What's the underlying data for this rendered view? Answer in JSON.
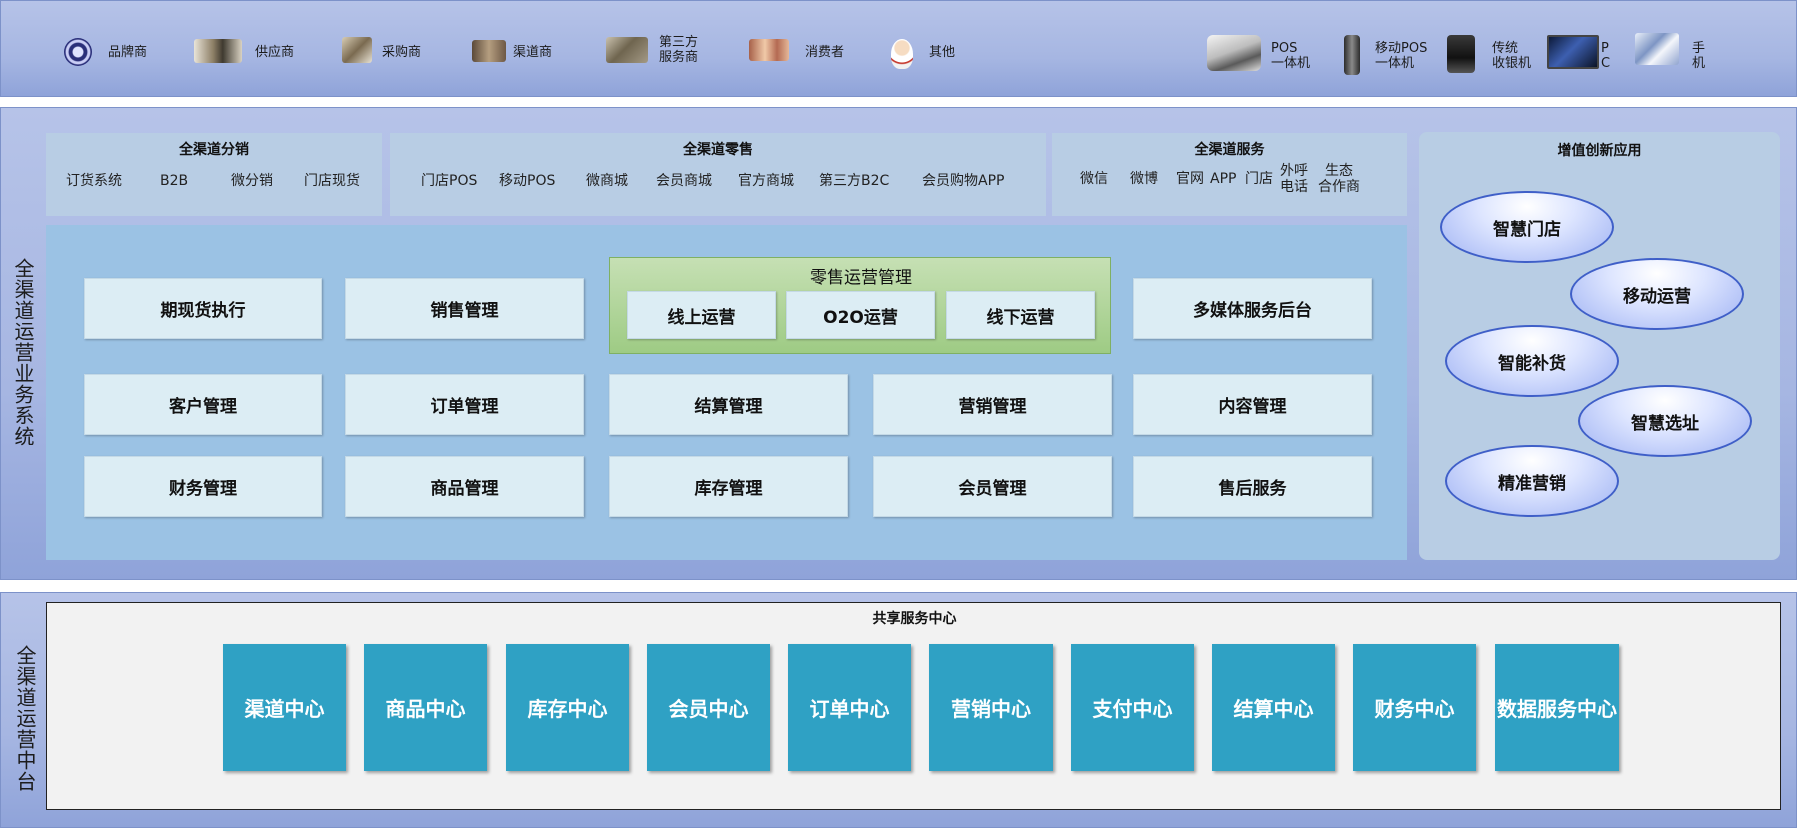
{
  "actors": {
    "left": [
      {
        "icon": "brand-seal-icon",
        "label": "品牌商"
      },
      {
        "icon": "supplier-photo-icon",
        "label": "供应商"
      },
      {
        "icon": "buyer-photo-icon",
        "label": "采购商"
      },
      {
        "icon": "channel-photo-icon",
        "label": "渠道商"
      },
      {
        "icon": "third-party-photo-icon",
        "label": "第三方\n服务商"
      },
      {
        "icon": "consumer-photo-icon",
        "label": "消费者"
      },
      {
        "icon": "other-person-icon",
        "label": "其他"
      }
    ],
    "devices": [
      {
        "icon": "pos-terminal-icon",
        "label": "POS\n一体机"
      },
      {
        "icon": "mobile-pos-icon",
        "label": "移动POS\n一体机"
      },
      {
        "icon": "cash-register-icon",
        "label": "传统\n收银机"
      },
      {
        "icon": "pc-monitor-icon",
        "label": "P\nC"
      },
      {
        "icon": "mobile-phone-icon",
        "label": "手\n机"
      }
    ]
  },
  "business_system": {
    "side_label": "全渠道运营业务系统",
    "distribution": {
      "title": "全渠道分销",
      "items": [
        "订货系统",
        "B2B",
        "微分销",
        "门店现货"
      ]
    },
    "retail": {
      "title": "全渠道零售",
      "items": [
        "门店POS",
        "移动POS",
        "微商城",
        "会员商城",
        "官方商城",
        "第三方B2C",
        "会员购物APP"
      ]
    },
    "service": {
      "title": "全渠道服务",
      "items": [
        "微信",
        "微博",
        "官网",
        "APP",
        "门店",
        "外呼\n电话",
        "生态\n合作商"
      ]
    },
    "retail_ops": {
      "title": "零售运营管理",
      "items": [
        "线上运营",
        "O2O运营",
        "线下运营"
      ]
    },
    "modules": {
      "row1": [
        "期现货执行",
        "销售管理",
        "多媒体服务后台"
      ],
      "row2": [
        "客户管理",
        "订单管理",
        "结算管理",
        "营销管理",
        "内容管理"
      ],
      "row3": [
        "财务管理",
        "商品管理",
        "库存管理",
        "会员管理",
        "售后服务"
      ]
    },
    "value_added": {
      "title": "增值创新应用",
      "items": [
        "智慧门店",
        "移动运营",
        "智能补货",
        "智慧选址",
        "精准营销"
      ]
    }
  },
  "middle_platform": {
    "side_label": "全渠道运营中台",
    "title": "共享服务中心",
    "centers": [
      "渠道中心",
      "商品中心",
      "库存中心",
      "会员中心",
      "订单中心",
      "营销中心",
      "支付中心",
      "结算中心",
      "财务中心",
      "数据服务中心"
    ]
  },
  "colors": {
    "center_tile": "#2fa1c4",
    "module_tile": "#dcedf4",
    "retail_ops_green": "#a9d18e",
    "oval_border": "#3f5fc8",
    "panel": "#a6b6e2"
  }
}
